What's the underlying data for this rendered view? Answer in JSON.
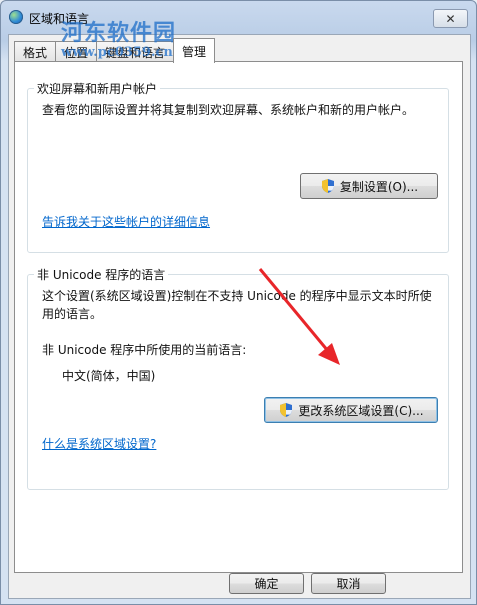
{
  "window": {
    "title": "区域和语言",
    "close_label": "✕"
  },
  "watermark": {
    "main": "河东软件园",
    "sub": "www.pc0359.cn"
  },
  "tabs": [
    {
      "label": "格式",
      "active": false
    },
    {
      "label": "位置",
      "active": false
    },
    {
      "label": "键盘和语言",
      "active": false
    },
    {
      "label": "管理",
      "active": true
    }
  ],
  "welcome_group": {
    "title": "欢迎屏幕和新用户帐户",
    "description": "查看您的国际设置并将其复制到欢迎屏幕、系统帐户和新的用户帐户。",
    "copy_button": "复制设置(O)...",
    "info_link": "告诉我关于这些帐户的详细信息"
  },
  "unicode_group": {
    "title": "非 Unicode 程序的语言",
    "description_line1": "这个设置(系统区域设置)控制在不支持 Unicode 的程序中显示文本时所使",
    "description_line2": "用的语言。",
    "current_label": "非 Unicode 程序中所使用的当前语言:",
    "current_value": "中文(简体，中国)",
    "change_button": "更改系统区域设置(C)...",
    "help_link": "什么是系统区域设置?"
  },
  "footer": {
    "ok_button": "确定",
    "cancel_button": "取消"
  },
  "colors": {
    "link": "#0066cc",
    "arrow": "#e8262a"
  }
}
